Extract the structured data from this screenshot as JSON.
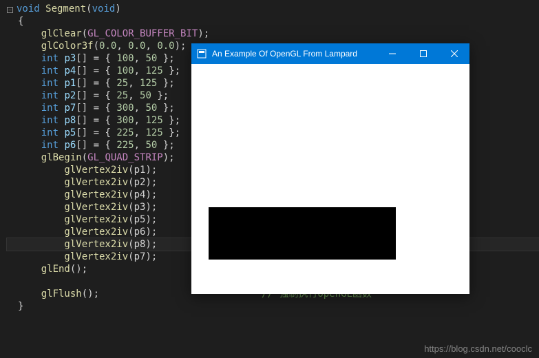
{
  "code": {
    "l0_fold": "−",
    "l0_kw1": "void",
    "l0_fn": " Segment",
    "l0_p1": "(",
    "l0_kw2": "void",
    "l0_p2": ")",
    "l1": "{",
    "l2_fn": "    glClear",
    "l2_p1": "(",
    "l2_const": "GL_COLOR_BUFFER_BIT",
    "l2_p2": ");",
    "l3_fn": "    glColor3f",
    "l3_p1": "(",
    "l3_n1": "0.0",
    "l3_c1": ", ",
    "l3_n2": "0.0",
    "l3_c2": ", ",
    "l3_n3": "0.0",
    "l3_p2": ");",
    "l4_t": "    int",
    "l4_v": " p3",
    "l4_b": "[] = { ",
    "l4_n1": "100",
    "l4_c": ", ",
    "l4_n2": "50",
    "l4_e": " };",
    "l5_t": "    int",
    "l5_v": " p4",
    "l5_b": "[] = { ",
    "l5_n1": "100",
    "l5_c": ", ",
    "l5_n2": "125",
    "l5_e": " };",
    "l6_t": "    int",
    "l6_v": " p1",
    "l6_b": "[] = { ",
    "l6_n1": "25",
    "l6_c": ", ",
    "l6_n2": "125",
    "l6_e": " };",
    "l7_t": "    int",
    "l7_v": " p2",
    "l7_b": "[] = { ",
    "l7_n1": "25",
    "l7_c": ", ",
    "l7_n2": "50",
    "l7_e": " };",
    "l8_t": "    int",
    "l8_v": " p7",
    "l8_b": "[] = { ",
    "l8_n1": "300",
    "l8_c": ", ",
    "l8_n2": "50",
    "l8_e": " };",
    "l9_t": "    int",
    "l9_v": " p8",
    "l9_b": "[] = { ",
    "l9_n1": "300",
    "l9_c": ", ",
    "l9_n2": "125",
    "l9_e": " };",
    "l10_t": "    int",
    "l10_v": " p5",
    "l10_b": "[] = { ",
    "l10_n1": "225",
    "l10_c": ", ",
    "l10_n2": "125",
    "l10_e": " };",
    "l11_t": "    int",
    "l11_v": " p6",
    "l11_b": "[] = { ",
    "l11_n1": "225",
    "l11_c": ", ",
    "l11_n2": "50",
    "l11_e": " };",
    "l12_fn": "    glBegin",
    "l12_p1": "(",
    "l12_const": "GL_QUAD_STRIP",
    "l12_p2": ");",
    "l13_fn": "        glVertex2iv",
    "l13_p": "(p1);",
    "l14_fn": "        glVertex2iv",
    "l14_p": "(p2);",
    "l15_fn": "        glVertex2iv",
    "l15_p": "(p4);",
    "l16_fn": "        glVertex2iv",
    "l16_p": "(p3);",
    "l17_fn": "        glVertex2iv",
    "l17_p": "(p5);",
    "l18_fn": "        glVertex2iv",
    "l18_p": "(p6);",
    "l19_fn": "        glVertex2iv",
    "l19_p": "(p8);",
    "l20_fn": "        glVertex2iv",
    "l20_p": "(p7);",
    "l21_fn": "    glEnd",
    "l21_p": "();",
    "l22": "",
    "l23_fn": "    glFlush",
    "l23_p": "();",
    "l23_sp": "                            ",
    "l23_cm": "// 强制执行openGL函数",
    "l24": "}"
  },
  "window": {
    "title": "An Example Of OpenGL From Lampard"
  },
  "watermark": "https://blog.csdn.net/cooclc"
}
